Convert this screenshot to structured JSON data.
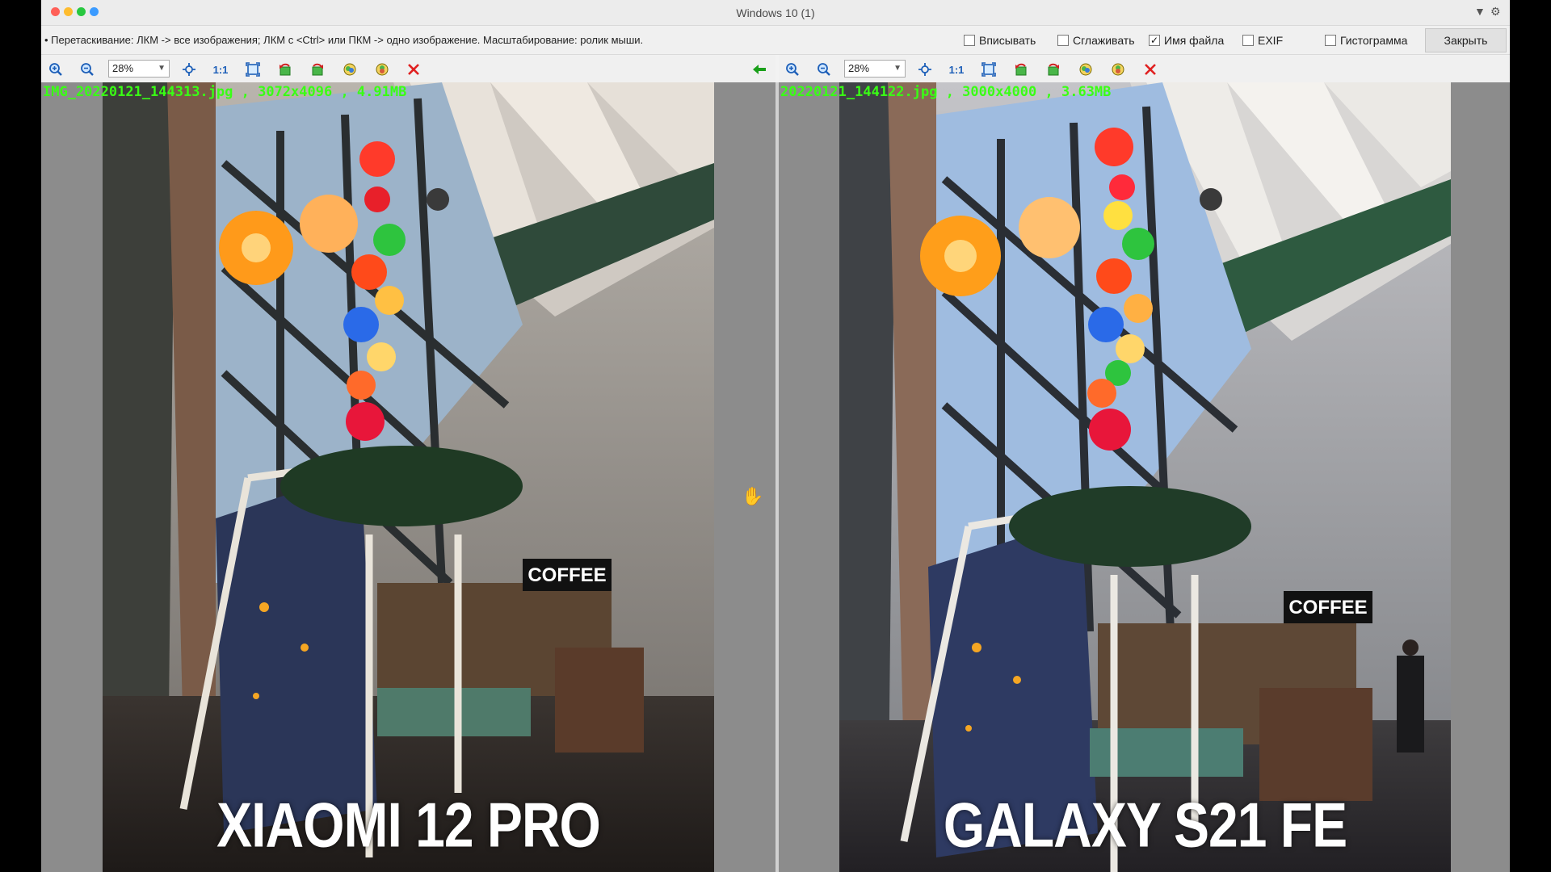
{
  "window": {
    "title": "Windows 10 (1)",
    "menu_arrow": "▼",
    "gear_glyph": "⚙"
  },
  "options": {
    "hint": "• Перетаскивание: ЛКМ -> все изображения; ЛКМ с <Ctrl> или ПКМ -> одно изображение. Масштабирование: ролик мыши.",
    "fit_label": "Вписывать",
    "smooth_label": "Сглаживать",
    "filename_label": "Имя файла",
    "exif_label": "EXIF",
    "histogram_label": "Гистограмма",
    "filename_checked": "✓",
    "close_label": "Закрыть"
  },
  "left": {
    "zoom": "28%",
    "one_to_one": "1:1",
    "fileinfo": "IMG_20220121_144313.jpg , 3072x4096 , 4.91MB",
    "caption": "XIAOMI 12 PRO"
  },
  "right": {
    "zoom": "28%",
    "one_to_one": "1:1",
    "fileinfo": "20220121_144122.jpg , 3000x4000 , 3.63MB",
    "caption": "GALAXY S21 FE"
  },
  "colors": {
    "info_green": "#39ff14",
    "close_red": "#e02020",
    "arrow_green": "#1aa01a"
  }
}
